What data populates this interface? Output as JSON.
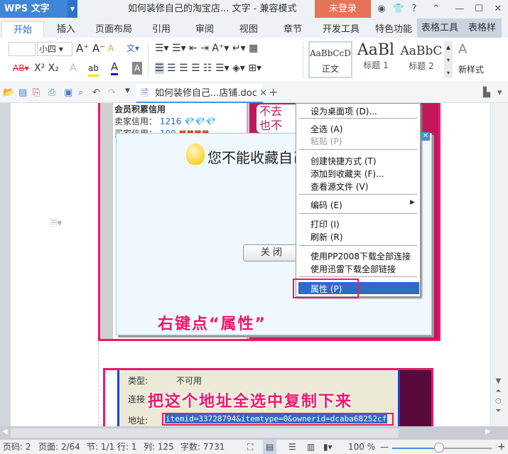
{
  "titlebar": {
    "app": "WPS 文字",
    "title": "如何装修自己的淘宝店... 文字 - 兼容模式",
    "login": "未登录"
  },
  "tabs": [
    "开始",
    "插入",
    "页面布局",
    "引用",
    "审阅",
    "视图",
    "章节",
    "开发工具",
    "特色功能",
    "表格工具",
    "表格样"
  ],
  "ribbon": {
    "font_size": "小四",
    "styles": [
      "AaBbCcD",
      "AaBl",
      "AaBbC"
    ],
    "style_names": [
      "正文",
      "标题 1",
      "标题 2"
    ],
    "new_style": "新样式"
  },
  "doc_tab": {
    "name": "如何装修自己...店铺.doc"
  },
  "image1": {
    "credit_title": "会员积累信用",
    "seller_label": "卖家信用：",
    "seller_value": "1216",
    "buyer_label": "买家信用：",
    "buyer_value": "100",
    "side_text": "不去\n也不",
    "dialog_message": "您不能收藏自己",
    "close_button": "关 闭",
    "annotation": "右键点“属性”"
  },
  "context_menu": {
    "items": [
      {
        "label": "设为桌面项 (D)..."
      },
      {
        "label": "全选 (A)"
      },
      {
        "label": "粘贴 (P)",
        "disabled": true
      },
      {
        "label": "创建快捷方式 (T)"
      },
      {
        "label": "添加到收藏夹 (F)..."
      },
      {
        "label": "查看源文件 (V)"
      },
      {
        "label": "编码 (E)"
      },
      {
        "label": "打印 (I)"
      },
      {
        "label": "刷新 (R)"
      },
      {
        "label": "使用PP2008下载全部连接"
      },
      {
        "label": "使用迅雷下载全部链接"
      },
      {
        "label": "属性 (P)",
        "highlighted": true
      }
    ]
  },
  "image2": {
    "type_label": "类型:",
    "type_value": "不可用",
    "link_label": "连接",
    "addr_label": "地址:",
    "addr_value": "itemid=33728794&itemtype=0&ownerid=dcaba68252cf",
    "annotation": "把这个地址全选中复制下来"
  },
  "status": {
    "page": "页码: 2",
    "pages": "页面: 2/64",
    "section": "节: 1/1",
    "row": "行: 1",
    "col": "列: 125",
    "words": "字数: 7731",
    "zoom": "100 %"
  },
  "zoom_fraction": 0.45
}
